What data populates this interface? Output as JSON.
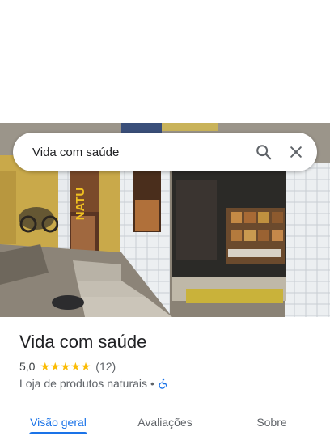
{
  "search": {
    "query": "Vida com saúde",
    "search_icon": "search-icon",
    "close_icon": "close-icon"
  },
  "photo": {
    "banner_text": "PRODUTOS NATURAIS"
  },
  "place": {
    "name": "Vida com saúde",
    "rating": "5,0",
    "stars": "★★★★★",
    "star_fill_fraction": 1.0,
    "review_count": "(12)",
    "category": "Loja de produtos naturais",
    "separator": "•",
    "accessibility_icon": "wheelchair-accessible-icon"
  },
  "tabs": [
    {
      "label": "Visão geral",
      "active": true
    },
    {
      "label": "Avaliações",
      "active": false
    },
    {
      "label": "Sobre",
      "active": false
    }
  ],
  "colors": {
    "accent": "#1a73e8",
    "star": "#fbbc04",
    "text_primary": "#202124",
    "text_secondary": "#5f6368"
  }
}
